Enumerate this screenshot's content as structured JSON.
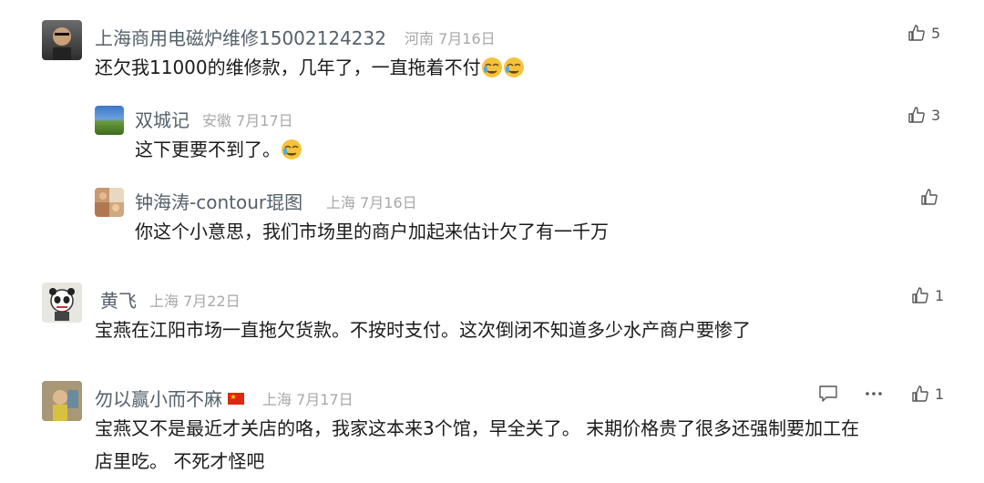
{
  "comments": [
    {
      "name": "上海商用电磁炉维修15002124232",
      "location": "河南",
      "date": "7月16日",
      "text": "还欠我11000的维修款，几年了，一直拖着不付",
      "likes": "5"
    },
    {
      "name": "双城记",
      "location": "安徽",
      "date": "7月17日",
      "text": "这下更要不到了。",
      "likes": "3"
    },
    {
      "name": "钟海涛-contour琨图",
      "location": "上海",
      "date": "7月16日",
      "text": "你这个小意思，我们市场里的商户加起来估计欠了有一千万",
      "likes": ""
    },
    {
      "name": "黄飞",
      "location": "上海",
      "date": "7月22日",
      "text": "宝燕在江阳市场一直拖欠货款。不按时支付。这次倒闭不知道多少水产商户要惨了",
      "likes": "1"
    },
    {
      "name": "勿以赢小而不麻",
      "location": "上海",
      "date": "7月17日",
      "text_line1": "宝燕又不是最近才关店的咯，我家这本来3个馆，早全关了。 末期价格贵了很多还强制要加工在",
      "text_line2": "店里吃。 不死才怪吧",
      "likes": "1",
      "flag": "🇨🇳"
    }
  ],
  "icons": {
    "like": "thumbs-up-icon",
    "reply": "comment-icon",
    "more": "more-dots-icon",
    "emoji": "facepalm-emoji"
  }
}
